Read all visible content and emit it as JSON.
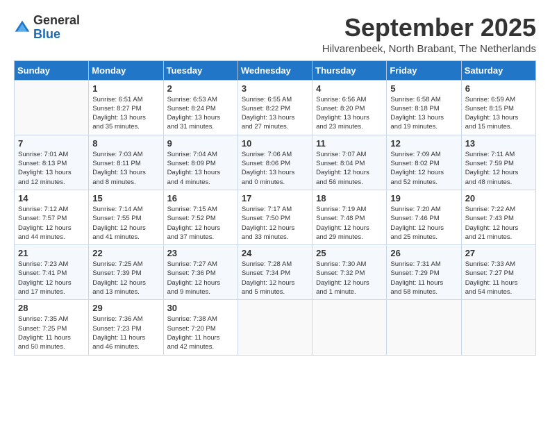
{
  "header": {
    "logo_general": "General",
    "logo_blue": "Blue",
    "month_title": "September 2025",
    "subtitle": "Hilvarenbeek, North Brabant, The Netherlands"
  },
  "days_of_week": [
    "Sunday",
    "Monday",
    "Tuesday",
    "Wednesday",
    "Thursday",
    "Friday",
    "Saturday"
  ],
  "weeks": [
    [
      {
        "day": "",
        "info": ""
      },
      {
        "day": "1",
        "info": "Sunrise: 6:51 AM\nSunset: 8:27 PM\nDaylight: 13 hours\nand 35 minutes."
      },
      {
        "day": "2",
        "info": "Sunrise: 6:53 AM\nSunset: 8:24 PM\nDaylight: 13 hours\nand 31 minutes."
      },
      {
        "day": "3",
        "info": "Sunrise: 6:55 AM\nSunset: 8:22 PM\nDaylight: 13 hours\nand 27 minutes."
      },
      {
        "day": "4",
        "info": "Sunrise: 6:56 AM\nSunset: 8:20 PM\nDaylight: 13 hours\nand 23 minutes."
      },
      {
        "day": "5",
        "info": "Sunrise: 6:58 AM\nSunset: 8:18 PM\nDaylight: 13 hours\nand 19 minutes."
      },
      {
        "day": "6",
        "info": "Sunrise: 6:59 AM\nSunset: 8:15 PM\nDaylight: 13 hours\nand 15 minutes."
      }
    ],
    [
      {
        "day": "7",
        "info": "Sunrise: 7:01 AM\nSunset: 8:13 PM\nDaylight: 13 hours\nand 12 minutes."
      },
      {
        "day": "8",
        "info": "Sunrise: 7:03 AM\nSunset: 8:11 PM\nDaylight: 13 hours\nand 8 minutes."
      },
      {
        "day": "9",
        "info": "Sunrise: 7:04 AM\nSunset: 8:09 PM\nDaylight: 13 hours\nand 4 minutes."
      },
      {
        "day": "10",
        "info": "Sunrise: 7:06 AM\nSunset: 8:06 PM\nDaylight: 13 hours\nand 0 minutes."
      },
      {
        "day": "11",
        "info": "Sunrise: 7:07 AM\nSunset: 8:04 PM\nDaylight: 12 hours\nand 56 minutes."
      },
      {
        "day": "12",
        "info": "Sunrise: 7:09 AM\nSunset: 8:02 PM\nDaylight: 12 hours\nand 52 minutes."
      },
      {
        "day": "13",
        "info": "Sunrise: 7:11 AM\nSunset: 7:59 PM\nDaylight: 12 hours\nand 48 minutes."
      }
    ],
    [
      {
        "day": "14",
        "info": "Sunrise: 7:12 AM\nSunset: 7:57 PM\nDaylight: 12 hours\nand 44 minutes."
      },
      {
        "day": "15",
        "info": "Sunrise: 7:14 AM\nSunset: 7:55 PM\nDaylight: 12 hours\nand 41 minutes."
      },
      {
        "day": "16",
        "info": "Sunrise: 7:15 AM\nSunset: 7:52 PM\nDaylight: 12 hours\nand 37 minutes."
      },
      {
        "day": "17",
        "info": "Sunrise: 7:17 AM\nSunset: 7:50 PM\nDaylight: 12 hours\nand 33 minutes."
      },
      {
        "day": "18",
        "info": "Sunrise: 7:19 AM\nSunset: 7:48 PM\nDaylight: 12 hours\nand 29 minutes."
      },
      {
        "day": "19",
        "info": "Sunrise: 7:20 AM\nSunset: 7:46 PM\nDaylight: 12 hours\nand 25 minutes."
      },
      {
        "day": "20",
        "info": "Sunrise: 7:22 AM\nSunset: 7:43 PM\nDaylight: 12 hours\nand 21 minutes."
      }
    ],
    [
      {
        "day": "21",
        "info": "Sunrise: 7:23 AM\nSunset: 7:41 PM\nDaylight: 12 hours\nand 17 minutes."
      },
      {
        "day": "22",
        "info": "Sunrise: 7:25 AM\nSunset: 7:39 PM\nDaylight: 12 hours\nand 13 minutes."
      },
      {
        "day": "23",
        "info": "Sunrise: 7:27 AM\nSunset: 7:36 PM\nDaylight: 12 hours\nand 9 minutes."
      },
      {
        "day": "24",
        "info": "Sunrise: 7:28 AM\nSunset: 7:34 PM\nDaylight: 12 hours\nand 5 minutes."
      },
      {
        "day": "25",
        "info": "Sunrise: 7:30 AM\nSunset: 7:32 PM\nDaylight: 12 hours\nand 1 minute."
      },
      {
        "day": "26",
        "info": "Sunrise: 7:31 AM\nSunset: 7:29 PM\nDaylight: 11 hours\nand 58 minutes."
      },
      {
        "day": "27",
        "info": "Sunrise: 7:33 AM\nSunset: 7:27 PM\nDaylight: 11 hours\nand 54 minutes."
      }
    ],
    [
      {
        "day": "28",
        "info": "Sunrise: 7:35 AM\nSunset: 7:25 PM\nDaylight: 11 hours\nand 50 minutes."
      },
      {
        "day": "29",
        "info": "Sunrise: 7:36 AM\nSunset: 7:23 PM\nDaylight: 11 hours\nand 46 minutes."
      },
      {
        "day": "30",
        "info": "Sunrise: 7:38 AM\nSunset: 7:20 PM\nDaylight: 11 hours\nand 42 minutes."
      },
      {
        "day": "",
        "info": ""
      },
      {
        "day": "",
        "info": ""
      },
      {
        "day": "",
        "info": ""
      },
      {
        "day": "",
        "info": ""
      }
    ]
  ]
}
